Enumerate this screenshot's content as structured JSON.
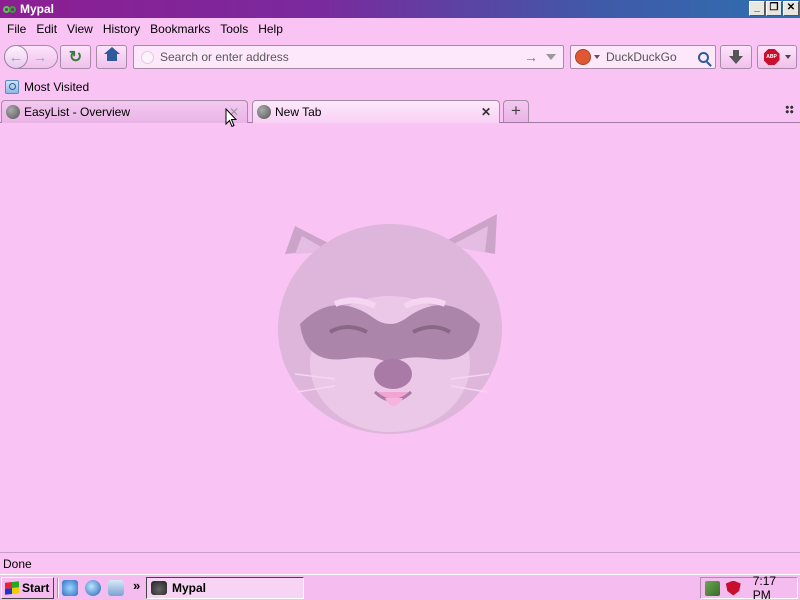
{
  "window": {
    "title": "Mypal",
    "controls": {
      "minimize": "_",
      "restore": "❐",
      "close": "✕"
    }
  },
  "menubar": {
    "items": [
      {
        "label": "File"
      },
      {
        "label": "Edit"
      },
      {
        "label": "View"
      },
      {
        "label": "History"
      },
      {
        "label": "Bookmarks"
      },
      {
        "label": "Tools"
      },
      {
        "label": "Help"
      }
    ]
  },
  "navbar": {
    "back_icon": "back-arrow-icon",
    "forward_icon": "forward-arrow-icon",
    "reload_glyph": "↻",
    "url_placeholder": "Search or enter address",
    "go_glyph": "→",
    "search_engine": "DuckDuckGo",
    "search_placeholder": "DuckDuckGo",
    "abp_label": "ABP"
  },
  "bookmarks": {
    "items": [
      {
        "label": "Most Visited",
        "icon": "most-visited-icon"
      }
    ]
  },
  "tabs": {
    "items": [
      {
        "label": "EasyList - Overview",
        "active": false
      },
      {
        "label": "New Tab",
        "active": true
      }
    ],
    "close_glyph": "✕",
    "new_tab_glyph": "+"
  },
  "content": {
    "image": "raccoon-face"
  },
  "statusbar": {
    "text": "Done"
  },
  "taskbar": {
    "start_label": "Start",
    "more_glyph": "»",
    "task_label": "Mypal",
    "clock": "7:17 PM"
  },
  "colors": {
    "theme_pink": "#f9c4f4",
    "titlebar_start": "#8c1e92",
    "titlebar_end": "#2f6fb0",
    "home_blue": "#2d5a9a",
    "abp_red": "#c8102e",
    "ddg_orange": "#de5833"
  }
}
